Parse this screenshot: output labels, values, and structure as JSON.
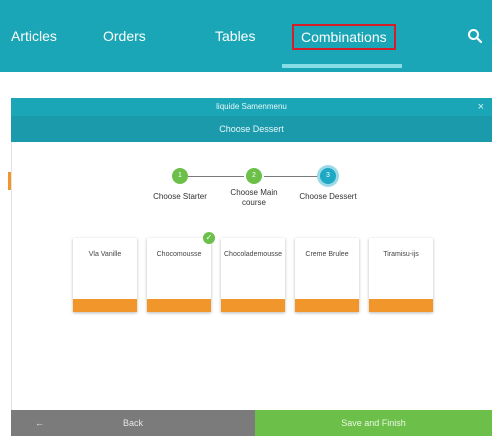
{
  "nav": {
    "items": [
      {
        "label": "Articles"
      },
      {
        "label": "Orders"
      },
      {
        "label": "Tables"
      },
      {
        "label": "Combinations",
        "active": true
      }
    ]
  },
  "modal": {
    "title": "liquide Samenmenu",
    "close_glyph": "×",
    "step_header": "Choose Dessert"
  },
  "stepper": {
    "steps": [
      {
        "number": "1",
        "label": "Choose Starter",
        "state": "done"
      },
      {
        "number": "2",
        "label": "Choose Main course",
        "state": "done"
      },
      {
        "number": "3",
        "label": "Choose Dessert",
        "state": "active"
      }
    ]
  },
  "cards": [
    {
      "name": "Vla Vanille",
      "selected": false
    },
    {
      "name": "Chocomousse",
      "selected": true
    },
    {
      "name": "Chocolademousse",
      "selected": false
    },
    {
      "name": "Creme Brulee",
      "selected": false
    },
    {
      "name": "Tiramisu-ijs",
      "selected": false
    }
  ],
  "footer": {
    "back_arrow": "←",
    "back_label": "Back",
    "finish_label": "Save and Finish"
  },
  "colors": {
    "primary": "#1aa6b6",
    "accent_orange": "#f0962a",
    "success_green": "#6cc04a",
    "highlight_red": "#d61e2a"
  },
  "icons": {
    "search": "search-icon",
    "close": "close-icon",
    "back": "arrow-left-icon",
    "check": "check-icon"
  }
}
